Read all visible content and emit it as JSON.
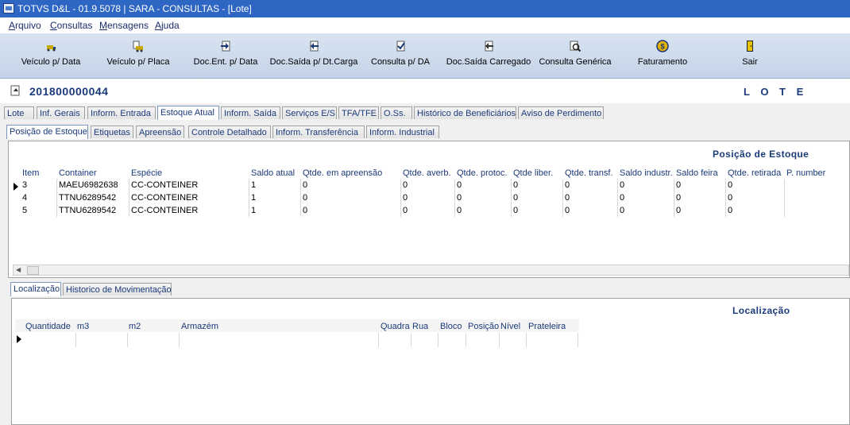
{
  "window": {
    "title": "TOTVS D&L - 01.9.5078 | SARA - CONSULTAS - [Lote]"
  },
  "menu": {
    "items": [
      "Arquivo",
      "Consultas",
      "Mensagens",
      "Ajuda"
    ]
  },
  "toolbar": {
    "buttons": [
      {
        "label": "Veículo p/ Data",
        "icon": "truck-calendar-icon"
      },
      {
        "label": "Veículo p/ Placa",
        "icon": "truck-plate-icon"
      },
      {
        "label": "Doc.Ent. p/ Data",
        "icon": "doc-entry-icon"
      },
      {
        "label": "Doc.Saída p/ Dt.Carga",
        "icon": "doc-exit-icon"
      },
      {
        "label": "Consulta p/ DA",
        "icon": "query-da-icon"
      },
      {
        "label": "Doc.Saída Carregado",
        "icon": "doc-loaded-icon"
      },
      {
        "label": "Consulta Genérica",
        "icon": "magnifier-doc-icon"
      },
      {
        "label": "Faturamento",
        "icon": "billing-icon"
      },
      {
        "label": "Sair",
        "icon": "exit-door-icon"
      }
    ]
  },
  "header": {
    "lote_number": "201800000044",
    "section": "L O T E"
  },
  "main_tabs": [
    "Lote",
    "Inf. Gerais",
    "Inform. Entrada",
    "Estoque Atual",
    "Inform. Saída",
    "Serviços E/S",
    "TFA/TFE",
    "O.Ss.",
    "Histórico de Beneficiários",
    "Aviso de Perdimento"
  ],
  "sub_tabs": [
    "Posição de Estoque",
    "Etiquetas",
    "Apreensão",
    "Controle Detalhado",
    "Inform. Transferência",
    "Inform. Industrial"
  ],
  "stock": {
    "title": "Posição de Estoque",
    "columns": [
      "Item",
      "Container",
      "Espécie",
      "Saldo atual",
      "Qtde. em apreensão",
      "Qtde. averb.",
      "Qtde. protoc.",
      "Qtde liber.",
      "Qtde. transf.",
      "Saldo industr.",
      "Saldo feira",
      "Qtde. retirada",
      "P. number"
    ],
    "rows": [
      [
        "3",
        "MAEU6982638",
        "CC-CONTEINER",
        "1",
        "0",
        "0",
        "0",
        "0",
        "0",
        "0",
        "0",
        "0",
        ""
      ],
      [
        "4",
        "TTNU6289542",
        "CC-CONTEINER",
        "1",
        "0",
        "0",
        "0",
        "0",
        "0",
        "0",
        "0",
        "0",
        ""
      ],
      [
        "5",
        "TTNU6289542",
        "CC-CONTEINER",
        "1",
        "0",
        "0",
        "0",
        "0",
        "0",
        "0",
        "0",
        "0",
        ""
      ]
    ]
  },
  "bottom_tabs": [
    "Localização",
    "Historico de Movimentação"
  ],
  "location": {
    "title": "Localização",
    "columns": [
      "Quantidade",
      "m3",
      "m2",
      "Armazém",
      "Quadra",
      "Rua",
      "Bloco",
      "Posição",
      "Nível",
      "Prateleira"
    ]
  }
}
